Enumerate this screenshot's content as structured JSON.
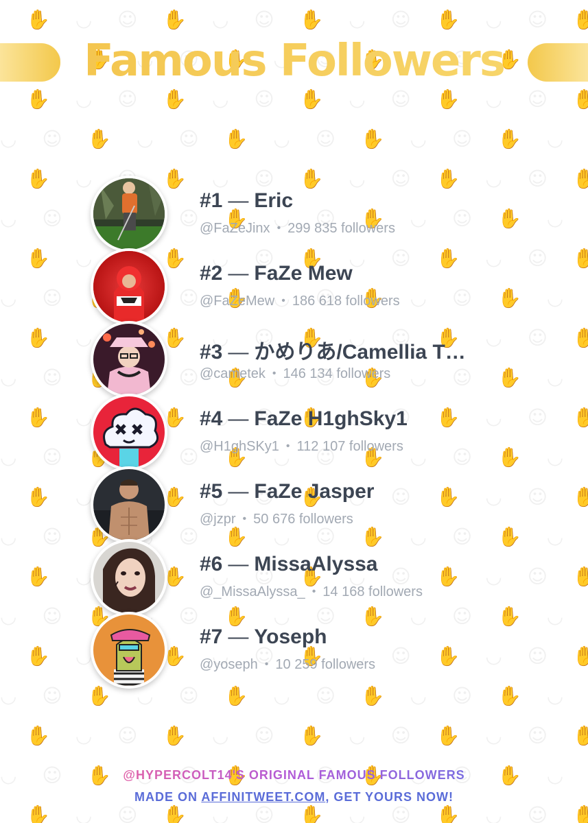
{
  "title": "Famous Followers",
  "colors": {
    "title": "#f4c430",
    "banner": "#f3c84b",
    "name_text": "#3c4553",
    "meta_text": "#a2a9b3",
    "footer_gradient_start": "#e060a8",
    "footer_gradient_end": "#7a6ce0",
    "footer_line2": "#5a6cd8"
  },
  "followers": [
    {
      "rank": "#1",
      "name": "Eric",
      "handle": "@FaZeJinx",
      "count": "299 835 followers",
      "avatar_icon": "person-golfing-avatar"
    },
    {
      "rank": "#2",
      "name": "FaZe Mew",
      "handle": "@FaZeMew",
      "count": "186 618 followers",
      "avatar_icon": "person-red-hoodie-avatar"
    },
    {
      "rank": "#3",
      "name": "かめりあ/Camellia T…",
      "handle": "@cametek",
      "count": "146 134 followers",
      "avatar_icon": "person-pink-hat-avatar"
    },
    {
      "rank": "#4",
      "name": "FaZe H1ghSky1",
      "handle": "@H1ghSKy1",
      "count": "112 107 followers",
      "avatar_icon": "cartoon-cloud-avatar"
    },
    {
      "rank": "#5",
      "name": "FaZe Jasper",
      "handle": "@jzpr",
      "count": "50 676 followers",
      "avatar_icon": "person-shirtless-avatar"
    },
    {
      "rank": "#6",
      "name": "MissaAlyssa",
      "handle": "@_MissaAlyssa_",
      "count": "14 168 followers",
      "avatar_icon": "person-portrait-avatar"
    },
    {
      "rank": "#7",
      "name": "Yoseph",
      "handle": "@yoseph",
      "count": "10 259 followers",
      "avatar_icon": "cartoon-ape-avatar"
    }
  ],
  "footer": {
    "line1": "@HYPERCOLT14'S ORIGINAL FAMOUS FOLLOWERS",
    "line2_prefix": "MADE ON ",
    "line2_link": "AFFINITWEET.COM",
    "line2_suffix": ", GET YOURS NOW!"
  }
}
